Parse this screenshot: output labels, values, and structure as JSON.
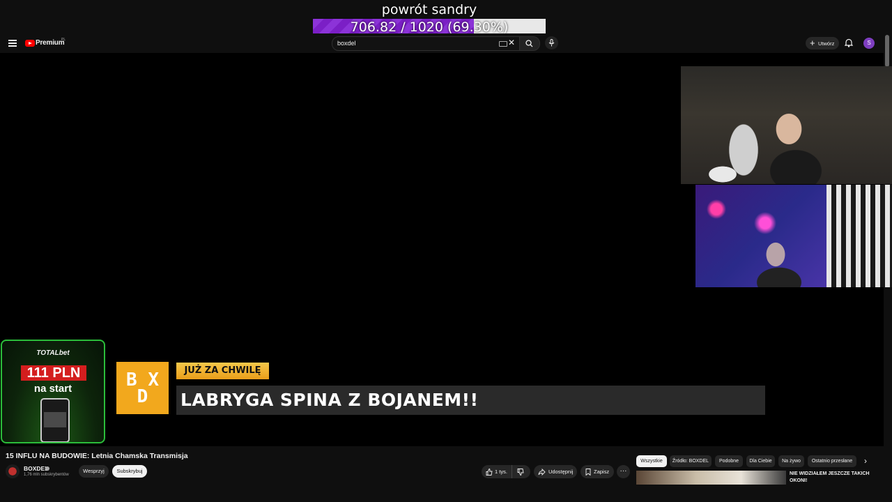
{
  "goal": {
    "title": "powrót sandry",
    "text": "706.82 / 1020 (69.30%)",
    "progress": 0.693
  },
  "topbar": {
    "logo_text": "Premium",
    "logo_country": "PL",
    "search_value": "boxdel",
    "create_label": "Utwórz",
    "avatar_letter": "S"
  },
  "ad": {
    "brand": "TOTALbet",
    "amount": "111 PLN",
    "subtitle": "na start"
  },
  "overlay": {
    "logo": "BXD",
    "badge": "JUŻ ZA CHWILĘ",
    "headline": "LABRYGA SPINA Z BOJANEM!!"
  },
  "video": {
    "title": "15 INFLU NA BUDOWIE: Letnia Chamska Transmisja",
    "channel": "BOXDEL",
    "subscribers": "1,76 mln subskrybentów",
    "support_label": "Wesprzyj",
    "subscribe_label": "Subskrybuj",
    "likes": "1 tys.",
    "share_label": "Udostępnij",
    "save_label": "Zapisz",
    "more_label": "···"
  },
  "chips": [
    "Wszystkie",
    "Źródło: BOXDEL",
    "Podobne",
    "Dla Ciebie",
    "Na żywo",
    "Ostatnio przesłane"
  ],
  "recommendation": {
    "title": "NIE WIDZIAŁEM JESZCZE TAKICH OKONI!"
  },
  "colors": {
    "accent_purple": "#7b1fc6",
    "youtube_red": "#ff0000",
    "badge_orange": "#f2a81d",
    "ad_green": "#2bbd3a"
  }
}
